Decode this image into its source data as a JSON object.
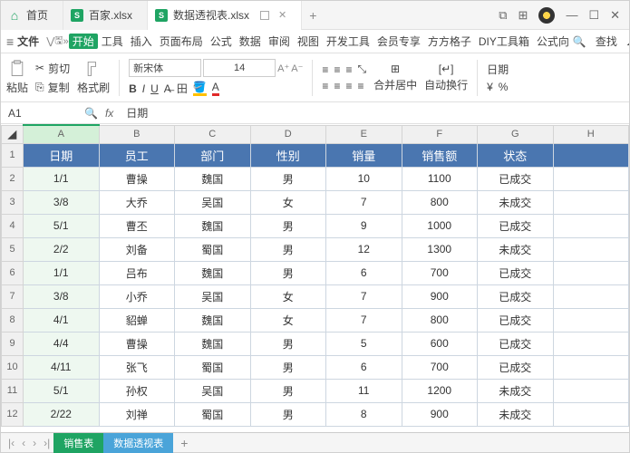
{
  "titlebar": {
    "homepage": "首页",
    "tabs": [
      {
        "label": "百家.xlsx"
      },
      {
        "label": "数据透视表.xlsx"
      }
    ]
  },
  "menu": {
    "file": "文件",
    "items": [
      "开始",
      "工具",
      "插入",
      "页面布局",
      "公式",
      "数据",
      "审阅",
      "视图",
      "开发工具",
      "会员专享",
      "方方格子",
      "DIY工具箱",
      "公式向"
    ],
    "search": "查找"
  },
  "toolbar": {
    "paste": "粘贴",
    "cut": "剪切",
    "copy": "复制",
    "brush": "格式刷",
    "font_name": "新宋体",
    "font_size": "14",
    "merge": "合并居中",
    "wrap": "自动换行",
    "date": "日期"
  },
  "namebox": {
    "ref": "A1",
    "formula": "日期"
  },
  "columns": [
    "A",
    "B",
    "C",
    "D",
    "E",
    "F",
    "G",
    "H"
  ],
  "rows": [
    {
      "n": "1",
      "c": [
        "日期",
        "员工",
        "部门",
        "性别",
        "销量",
        "销售额",
        "状态",
        ""
      ]
    },
    {
      "n": "2",
      "c": [
        "1/1",
        "曹操",
        "魏国",
        "男",
        "10",
        "1100",
        "已成交",
        ""
      ]
    },
    {
      "n": "3",
      "c": [
        "3/8",
        "大乔",
        "吴国",
        "女",
        "7",
        "800",
        "未成交",
        ""
      ]
    },
    {
      "n": "4",
      "c": [
        "5/1",
        "曹丕",
        "魏国",
        "男",
        "9",
        "1000",
        "已成交",
        ""
      ]
    },
    {
      "n": "5",
      "c": [
        "2/2",
        "刘备",
        "蜀国",
        "男",
        "12",
        "1300",
        "未成交",
        ""
      ]
    },
    {
      "n": "6",
      "c": [
        "1/1",
        "吕布",
        "魏国",
        "男",
        "6",
        "700",
        "已成交",
        ""
      ]
    },
    {
      "n": "7",
      "c": [
        "3/8",
        "小乔",
        "吴国",
        "女",
        "7",
        "900",
        "已成交",
        ""
      ]
    },
    {
      "n": "8",
      "c": [
        "4/1",
        "貂蝉",
        "魏国",
        "女",
        "7",
        "800",
        "已成交",
        ""
      ]
    },
    {
      "n": "9",
      "c": [
        "4/4",
        "曹操",
        "魏国",
        "男",
        "5",
        "600",
        "已成交",
        ""
      ]
    },
    {
      "n": "10",
      "c": [
        "4/11",
        "张飞",
        "蜀国",
        "男",
        "6",
        "700",
        "已成交",
        ""
      ]
    },
    {
      "n": "11",
      "c": [
        "5/1",
        "孙权",
        "吴国",
        "男",
        "11",
        "1200",
        "未成交",
        ""
      ]
    },
    {
      "n": "12",
      "c": [
        "2/22",
        "刘禅",
        "蜀国",
        "男",
        "8",
        "900",
        "未成交",
        ""
      ]
    }
  ],
  "tabs": {
    "active": "销售表",
    "pivot": "数据透视表"
  }
}
